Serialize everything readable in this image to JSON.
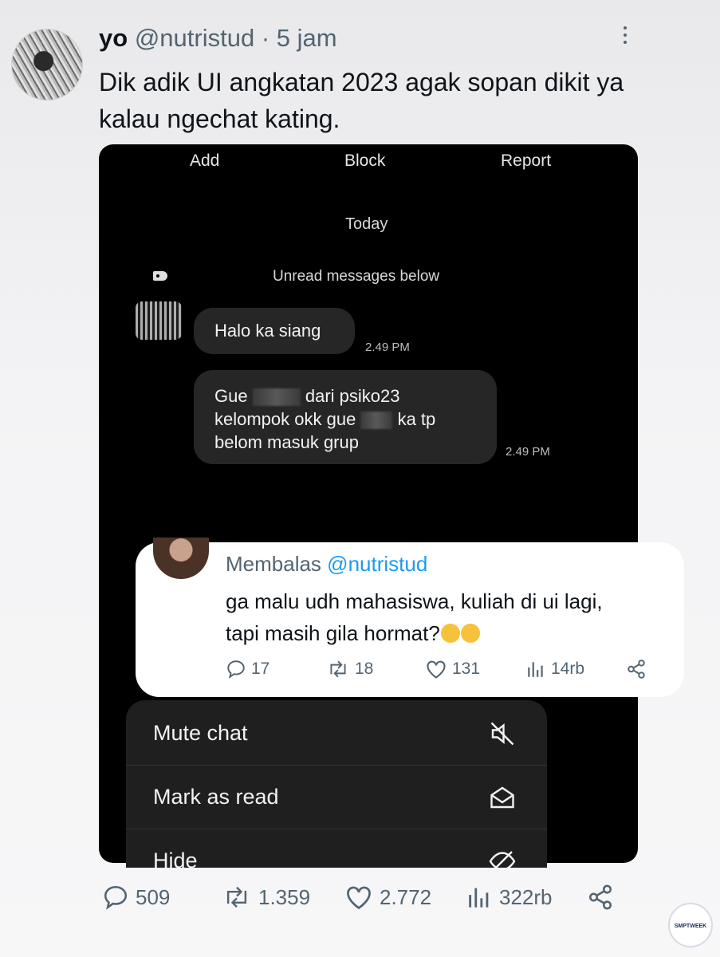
{
  "tweet": {
    "name": "yo",
    "handle": "@nutristud",
    "separator": "·",
    "time": "5 jam",
    "text": "Dik adik UI angkatan 2023 agak sopan dikit ya kalau ngechat kating."
  },
  "chat_screenshot": {
    "actions": [
      "Add",
      "Block",
      "Report"
    ],
    "date_divider": "Today",
    "unread_label": "Unread messages below",
    "messages": [
      {
        "text": "Halo ka siang",
        "time": "2.49 PM"
      },
      {
        "line1_start": "Gue",
        "line1_end": "dari psiko23",
        "line2_start": "kelompok okk gue",
        "line2_end": "ka tp",
        "line3": "belom masuk grup",
        "time": "2.49 PM"
      }
    ],
    "menu": [
      {
        "label": "Mute chat",
        "icon": "mute-icon"
      },
      {
        "label": "Mark as read",
        "icon": "envelope-open-icon"
      },
      {
        "label": "Hide",
        "icon": "hide-icon"
      }
    ]
  },
  "reply": {
    "prefix": "Membalas",
    "mention": "@nutristud",
    "line1": "ga malu udh mahasiswa, kuliah di ui lagi,",
    "line2": "tapi masih gila hormat?",
    "metrics": {
      "replies": "17",
      "reposts": "18",
      "likes": "131",
      "views": "14rb"
    }
  },
  "footer": {
    "replies": "509",
    "reposts": "1.359",
    "likes": "2.772",
    "views": "322rb"
  },
  "watermark": "SMPTWEEK",
  "colors": {
    "accent": "#1d9bf0",
    "secondary_text": "#536471",
    "chat_bg": "#000000",
    "bubble": "#262626"
  }
}
